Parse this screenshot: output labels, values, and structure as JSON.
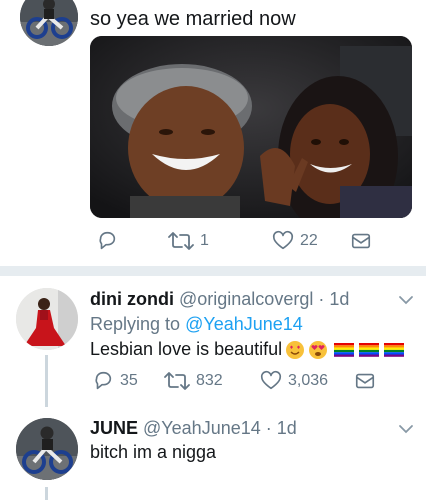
{
  "tweet1": {
    "text": "so yea we married now",
    "actions": {
      "retweets": "1",
      "likes": "22"
    }
  },
  "tweet2": {
    "display_name": "dini zondi",
    "handle": "@originalcovergl",
    "time": "· 1d",
    "replying_prefix": "Replying to ",
    "replying_handle": "@YeahJune14",
    "text": "Lesbian love is beautiful",
    "actions": {
      "replies": "35",
      "retweets": "832",
      "likes": "3,036"
    }
  },
  "tweet3": {
    "display_name": "JUNE",
    "handle": "@YeahJune14",
    "time": "· 1d",
    "text": "bitch im a nigga"
  },
  "icons": [
    "reply-icon",
    "retweet-icon",
    "like-icon",
    "share-icon",
    "chevron-down-icon"
  ],
  "colors": {
    "action_gray": "#657786",
    "link_blue": "#1da1f2",
    "divider": "#e6ecf0"
  }
}
